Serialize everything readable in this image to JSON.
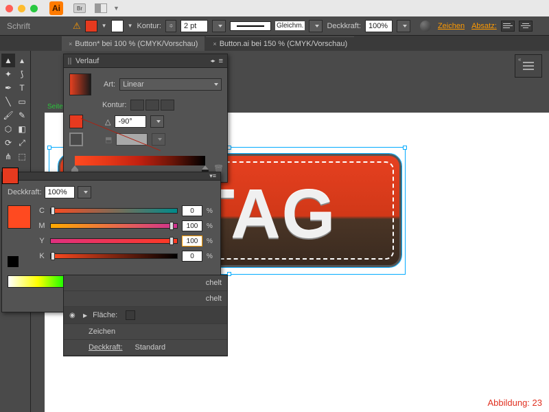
{
  "titlebar": {
    "ai": "Ai",
    "br": "Br"
  },
  "optbar": {
    "label": "Schrift",
    "warn": "⚠",
    "kontur": "Kontur:",
    "kontur_val": "2 pt",
    "gleichm": "Gleichm.",
    "deckkraft": "Deckkraft:",
    "deckkraft_val": "100%",
    "zeichen": "Zeichen",
    "absatz": "Absatz:"
  },
  "tabs": [
    {
      "x": "×",
      "label": "Button* bei 100 % (CMYK/Vorschau)"
    },
    {
      "x": "×",
      "label": "Button.ai bei 150 % (CMYK/Vorschau)"
    }
  ],
  "seite": "Seite",
  "vintage": "VINTAG",
  "gradient": {
    "title": "Verlauf",
    "art": "Art:",
    "art_val": "Linear",
    "kontur": "Kontur:",
    "angle": "-90°"
  },
  "color": {
    "deck": "Deckkraft:",
    "deck_val": "100%",
    "c": "C",
    "c_val": "0",
    "m": "M",
    "m_val": "100",
    "y": "Y",
    "y_val": "100",
    "k": "K",
    "k_val": "0",
    "pct": "%"
  },
  "appear": {
    "chelt": "chelt",
    "flaeche": "Fläche:",
    "zeichen": "Zeichen",
    "deck": "Deckkraft:",
    "std": "Standard"
  },
  "abb": "Abbildung: 23"
}
